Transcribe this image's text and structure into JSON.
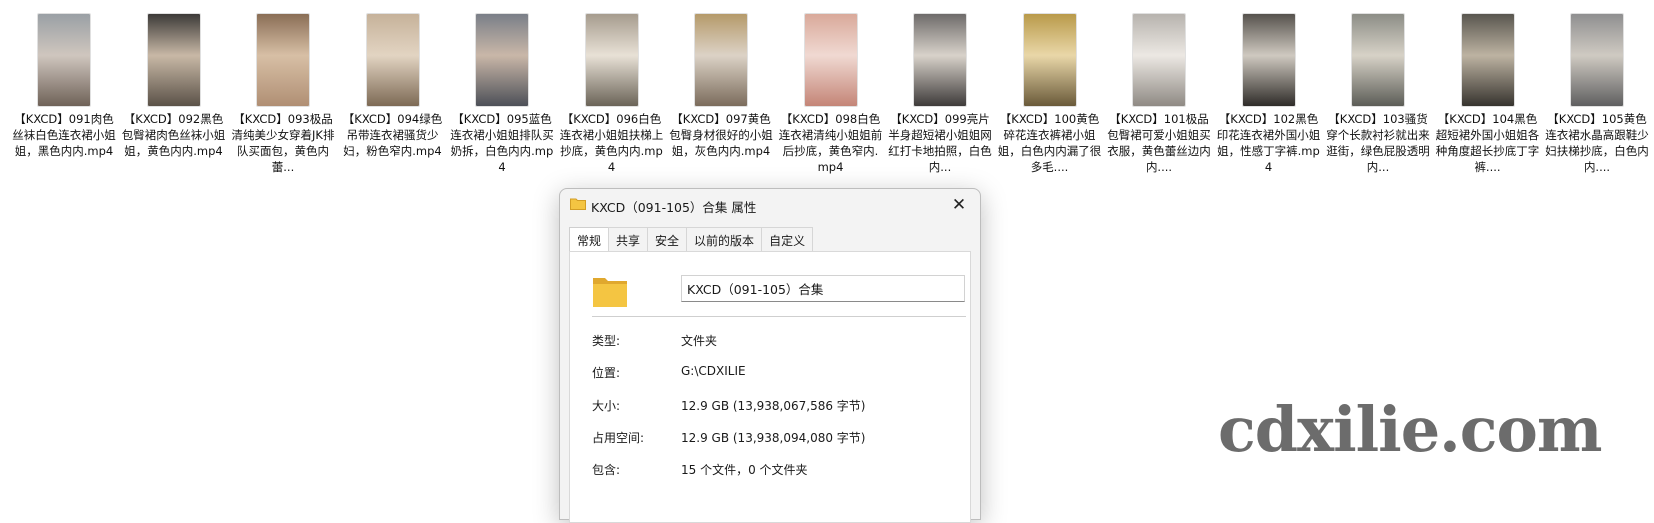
{
  "files": [
    {
      "label": "【KXCD】091肉色丝袜白色连衣裙小姐姐，黑色内内.mp4",
      "thumb": [
        "#9aa0a5",
        "#cfc6be",
        "#6f6258"
      ]
    },
    {
      "label": "【KXCD】092黑色包臀裙肉色丝袜小姐姐，黄色内内.mp4",
      "thumb": [
        "#3c3a38",
        "#c8b8a6",
        "#5b5248"
      ]
    },
    {
      "label": "【KXCD】093极品清纯美少女穿着JK排队买面包，黄色内蕾...",
      "thumb": [
        "#8a6e56",
        "#d7bfa5",
        "#b08f74"
      ]
    },
    {
      "label": "【KXCD】094绿色吊带连衣裙骚货少妇，粉色窄内.mp4",
      "thumb": [
        "#c6b29a",
        "#e2d4c2",
        "#7d6a55"
      ]
    },
    {
      "label": "【KXCD】095蓝色连衣裙小姐姐排队买奶拆，白色内内.mp4",
      "thumb": [
        "#7a7f88",
        "#c9b7a8",
        "#4d5058"
      ]
    },
    {
      "label": "【KXCD】096白色连衣裙小姐姐扶梯上抄底，黄色内内.mp4",
      "thumb": [
        "#a69c8e",
        "#e8e1d6",
        "#6b6458"
      ]
    },
    {
      "label": "【KXCD】097黄色包臀身材很好的小姐姐，灰色内内.mp4",
      "thumb": [
        "#b59a6a",
        "#dcd2c6",
        "#7b6c5c"
      ]
    },
    {
      "label": "【KXCD】098白色连衣裙清纯小姐姐前后抄底，黄色窄内.mp4",
      "thumb": [
        "#d9a99a",
        "#f0d9d2",
        "#c48577"
      ]
    },
    {
      "label": "【KXCD】099亮片半身超短裙小姐姐网红打卡地拍照，白色内...",
      "thumb": [
        "#6e6b6a",
        "#d8d2ca",
        "#3e3b3a"
      ]
    },
    {
      "label": "【KXCD】100黄色碎花连衣裤裙小姐姐，白色内内漏了很多毛....",
      "thumb": [
        "#b99a4a",
        "#e9d7a8",
        "#6a5a3a"
      ]
    },
    {
      "label": "【KXCD】101极品包臀裙可爱小姐姐买衣服，黄色蕾丝边内内....",
      "thumb": [
        "#b7b3ae",
        "#ece8e3",
        "#8f8a84"
      ]
    },
    {
      "label": "【KXCD】102黑色印花连衣裙外国小姐姐，性感丁字裤.mp4",
      "thumb": [
        "#56524d",
        "#cfc9c0",
        "#2f2c29"
      ]
    },
    {
      "label": "【KXCD】103骚货穿个长款衬衫就出来逛街，绿色屁股透明内...",
      "thumb": [
        "#8c8d86",
        "#d7d2c7",
        "#5c5d57"
      ]
    },
    {
      "label": "【KXCD】104黑色超短裙外国小姐姐各种角度超长抄底丁字裤....",
      "thumb": [
        "#59564f",
        "#bdb3a2",
        "#37342f"
      ]
    },
    {
      "label": "【KXCD】105黄色连衣裙水晶高跟鞋少妇扶梯抄底，白色内内....",
      "thumb": [
        "#8f8f90",
        "#cfcac2",
        "#5f5f60"
      ]
    }
  ],
  "dialog": {
    "title": "KXCD（091-105）合集 属性",
    "tabs": [
      "常规",
      "共享",
      "安全",
      "以前的版本",
      "自定义"
    ],
    "name_value": "KXCD（091-105）合集",
    "props": [
      {
        "key": "类型:",
        "value": "文件夹"
      },
      {
        "key": "位置:",
        "value": "G:\\CDXILIE"
      },
      {
        "key": "大小:",
        "value": "12.9 GB (13,938,067,586 字节)"
      },
      {
        "key": "占用空间:",
        "value": "12.9 GB (13,938,094,080 字节)"
      },
      {
        "key": "包含:",
        "value": "15 个文件，0 个文件夹"
      }
    ],
    "close_icon": "close-icon",
    "folder_icon": "folder-icon"
  },
  "watermark": "cdxilie.com",
  "colors": {
    "folder": "#f4c542",
    "folder_dark": "#e0a82e",
    "dialog_bg": "#f3f3f3"
  }
}
